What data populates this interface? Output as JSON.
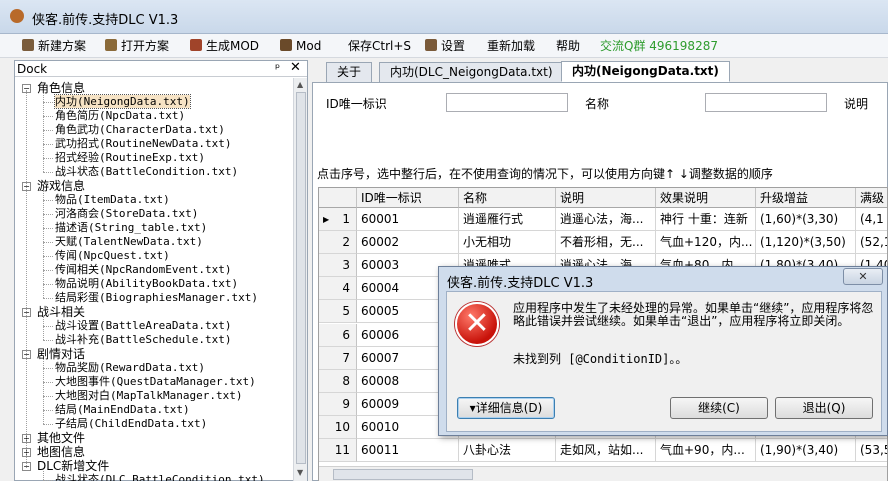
{
  "window": {
    "title": "侠客.前传.支持DLC V1.3"
  },
  "menu": [
    {
      "label": "新建方案",
      "icon": "new-scheme-icon",
      "color": "#7a5c3c"
    },
    {
      "label": "打开方案",
      "icon": "open-scheme-icon",
      "color": "#8a6a3a"
    },
    {
      "label": "生成MOD",
      "icon": "generate-mod-icon",
      "color": "#a0442a"
    },
    {
      "label": "Mod",
      "icon": "mod-icon",
      "color": "#6a4a2a"
    },
    {
      "label": "保存Ctrl+S",
      "icon": "",
      "color": ""
    },
    {
      "label": "设置",
      "icon": "settings-icon",
      "color": "#7a5a3a"
    },
    {
      "label": "重新加载",
      "icon": "",
      "color": ""
    },
    {
      "label": "帮助",
      "icon": "",
      "color": ""
    },
    {
      "label": "交流Q群 496198287",
      "icon": "",
      "color": "#2e9c2e"
    }
  ],
  "dock": {
    "title": "Dock",
    "pin": "ᵖ",
    "close": "✕",
    "tree": [
      {
        "label": "角色信息",
        "group": true,
        "expanded": true
      },
      {
        "label": "内功(NeigongData.txt)",
        "selected": true
      },
      {
        "label": "角色简历(NpcData.txt)"
      },
      {
        "label": "角色武功(CharacterData.txt)"
      },
      {
        "label": "武功招式(RoutineNewData.txt)"
      },
      {
        "label": "招式经验(RoutineExp.txt)"
      },
      {
        "label": "战斗状态(BattleCondition.txt)"
      },
      {
        "label": "游戏信息",
        "group": true,
        "expanded": true
      },
      {
        "label": "物品(ItemData.txt)"
      },
      {
        "label": "河洛商会(StoreData.txt)"
      },
      {
        "label": "描述语(String_table.txt)"
      },
      {
        "label": "天赋(TalentNewData.txt)"
      },
      {
        "label": "传闻(NpcQuest.txt)"
      },
      {
        "label": "传闻相关(NpcRandomEvent.txt)"
      },
      {
        "label": "物品说明(AbilityBookData.txt)"
      },
      {
        "label": "结局彩蛋(BiographiesManager.txt)"
      },
      {
        "label": "战斗相关",
        "group": true,
        "expanded": true
      },
      {
        "label": "战斗设置(BattleAreaData.txt)"
      },
      {
        "label": "战斗补充(BattleSchedule.txt)"
      },
      {
        "label": "剧情对话",
        "group": true,
        "expanded": true
      },
      {
        "label": "物品奖励(RewardData.txt)"
      },
      {
        "label": "大地图事件(QuestDataManager.txt)"
      },
      {
        "label": "大地图对白(MapTalkManager.txt)"
      },
      {
        "label": "结局(MainEndData.txt)"
      },
      {
        "label": "子结局(ChildEndData.txt)"
      },
      {
        "label": "其他文件",
        "group": true,
        "expanded": false
      },
      {
        "label": "地图信息",
        "group": true,
        "expanded": false
      },
      {
        "label": "DLC新增文件",
        "group": true,
        "expanded": true
      },
      {
        "label": "战斗状态(DLC BattleCondition.txt)"
      }
    ]
  },
  "tabs": [
    {
      "label": "关于",
      "active": false
    },
    {
      "label": "内功(DLC_NeigongData.txt)",
      "active": false
    },
    {
      "label": "内功(NeigongData.txt)",
      "active": true
    }
  ],
  "search": {
    "id_label": "ID唯一标识",
    "name_label": "名称",
    "desc_label": "说明",
    "id_value": "",
    "name_value": "",
    "desc_value": ""
  },
  "hint": "点击序号，选中整行后，在不使用查询的情况下，可以使用方向键↑ ↓调整数据的顺序",
  "grid": {
    "columns": [
      "ID唯一标识",
      "名称",
      "说明",
      "效果说明",
      "升级增益",
      "满级"
    ],
    "rows": [
      {
        "n": "1",
        "id": "60001",
        "name": "逍遥雁行式",
        "desc": "逍遥心法，海...",
        "effect": "神行 十重：连新",
        "upgrade": "(1,60)*(3,30)",
        "max": "(4,1"
      },
      {
        "n": "2",
        "id": "60002",
        "name": "小无相功",
        "desc": "不着形相，无...",
        "effect": "气血+120，内...",
        "upgrade": "(1,120)*(3,50)",
        "max": "(52,1"
      },
      {
        "n": "3",
        "id": "60003",
        "name": "逍遥唯式",
        "desc": "逍遥心法，海...",
        "effect": "气血+80，内...",
        "upgrade": "(1,80)*(3,40)",
        "max": "(1,40"
      },
      {
        "n": "4",
        "id": "60004",
        "name": "",
        "desc": "",
        "effect": "",
        "upgrade": "",
        "max": ""
      },
      {
        "n": "5",
        "id": "60005",
        "name": "",
        "desc": "",
        "effect": "",
        "upgrade": "",
        "max": ""
      },
      {
        "n": "6",
        "id": "60006",
        "name": "",
        "desc": "",
        "effect": "",
        "upgrade": "",
        "max": ""
      },
      {
        "n": "7",
        "id": "60007",
        "name": "",
        "desc": "",
        "effect": "",
        "upgrade": "",
        "max": ""
      },
      {
        "n": "8",
        "id": "60008",
        "name": "",
        "desc": "",
        "effect": "",
        "upgrade": "",
        "max": ""
      },
      {
        "n": "9",
        "id": "60009",
        "name": "",
        "desc": "",
        "effect": "",
        "upgrade": "",
        "max": ""
      },
      {
        "n": "10",
        "id": "60010",
        "name": "",
        "desc": "",
        "effect": "",
        "upgrade": "",
        "max": ""
      },
      {
        "n": "11",
        "id": "60011",
        "name": "八卦心法",
        "desc": "走如风，站如...",
        "effect": "气血+90，内...",
        "upgrade": "(1,90)*(3,40)",
        "max": "(53,5"
      }
    ]
  },
  "dialog": {
    "title": "侠客.前传.支持DLC V1.3",
    "close": "✕",
    "message": "应用程序中发生了未经处理的异常。如果单击“继续”，应用程序将忽略此错误并尝试继续。如果单击“退出”，应用程序将立即关闭。",
    "detail": "未找到列 [@ConditionID]。。",
    "btn_details": "▾详细信息(D)",
    "btn_continue": "继续(C)",
    "btn_quit": "退出(Q)"
  }
}
